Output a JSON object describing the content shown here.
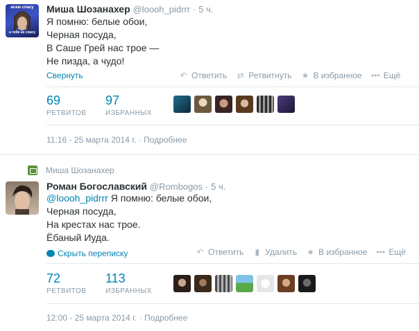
{
  "tweet1": {
    "fullname": "Миша Шозанахер",
    "username": "@loooh_pidrrr",
    "dot": "·",
    "time": "5 ч.",
    "lines": [
      "Я помню: белые обои,",
      "Черная посуда,",
      "В Саше Грей нас трое —",
      "Не пизда, а чудо!"
    ],
    "toggle_label": "Свернуть",
    "actions": {
      "reply": "Ответить",
      "retweet": "Ретвитнуть",
      "favorite": "В избранное",
      "more": "Ещё"
    },
    "retweets_count": "69",
    "retweets_label": "РЕТВИТОВ",
    "favorites_count": "97",
    "favorites_label": "ИЗБРАННЫХ",
    "meta_time": "11:16 - 25 марта 2014 г.",
    "meta_sep": "·",
    "meta_details": "Подробнее",
    "avatar_text_top": "всем спасу",
    "avatar_text_bottom": "а тебя не спасу"
  },
  "tweet2": {
    "retweeted_by": "Миша Шозанахер",
    "fullname": "Роман Богославский",
    "username": "@Rombogos",
    "dot": "·",
    "time": "5 ч.",
    "mention": "@loooh_pidrrr",
    "first_line_rest": " Я помню: белые обои,",
    "lines": [
      "Черная посуда,",
      "На крестах нас трое.",
      "Ёбаный Иуда."
    ],
    "toggle_label": "Скрыть переписку",
    "actions": {
      "reply": "Ответить",
      "delete": "Удалить",
      "favorite": "В избранное",
      "more": "Ещё"
    },
    "retweets_count": "72",
    "retweets_label": "РЕТВИТОВ",
    "favorites_count": "113",
    "favorites_label": "ИЗБРАННЫХ",
    "meta_time": "12:00 - 25 марта 2014 г.",
    "meta_sep": "·",
    "meta_details": "Подробнее"
  },
  "colors": {
    "link": "#0084b4",
    "muted": "#8899a6",
    "text": "#292f33",
    "retweet_green": "#5c913b"
  },
  "icons": {
    "reply": "reply-icon",
    "retweet": "retweet-icon",
    "favorite": "star-icon",
    "more": "more-icon",
    "delete": "trash-icon",
    "conversation": "speech-bubble-icon"
  }
}
